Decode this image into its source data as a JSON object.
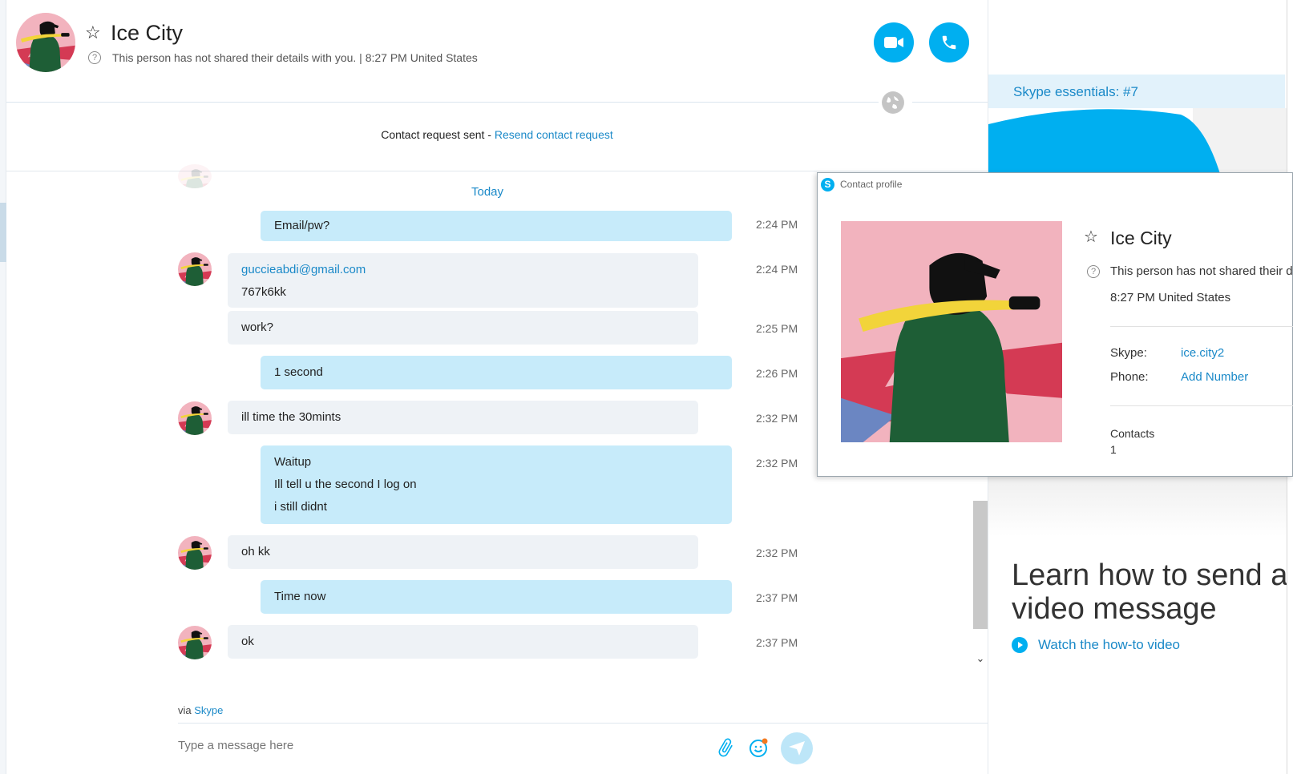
{
  "header": {
    "contact_name": "Ice City",
    "status_text": "This person has not shared their details with you.  |  8:27 PM United States"
  },
  "request": {
    "sent_text": "Contact request sent - ",
    "resend_link": "Resend contact request"
  },
  "chat": {
    "day_label": "Today",
    "messages": [
      {
        "direction": "out",
        "lines": [
          "Email/pw?"
        ],
        "time": "2:24 PM"
      },
      {
        "direction": "in",
        "lines": [
          "guccieabdi@gmail.com",
          "767k6kk"
        ],
        "time": "2:24 PM"
      },
      {
        "direction": "in",
        "lines": [
          "work?"
        ],
        "time": "2:25 PM"
      },
      {
        "direction": "out",
        "lines": [
          "1 second"
        ],
        "time": "2:26 PM"
      },
      {
        "direction": "in",
        "lines": [
          "ill time the 30mints"
        ],
        "time": "2:32 PM"
      },
      {
        "direction": "out",
        "lines": [
          "Waitup",
          "Ill tell u the second I log on",
          "i still didnt"
        ],
        "time": "2:32 PM"
      },
      {
        "direction": "in",
        "lines": [
          "oh kk"
        ],
        "time": "2:32 PM"
      },
      {
        "direction": "out",
        "lines": [
          "Time now"
        ],
        "time": "2:37 PM"
      },
      {
        "direction": "in",
        "lines": [
          "ok"
        ],
        "time": "2:37 PM"
      }
    ]
  },
  "composer": {
    "via_prefix": "via ",
    "via_link": "Skype",
    "placeholder": "Type a message here"
  },
  "side_panel": {
    "essentials": "Skype essentials: #7",
    "learn_title": "Learn how to send a video message",
    "watch_link": "Watch the how-to video"
  },
  "profile_popup": {
    "window_title": "Contact profile",
    "name": "Ice City",
    "details_text": "This person has not shared their de",
    "location": "8:27 PM United States",
    "skype_label": "Skype:",
    "skype_value": "ice.city2",
    "phone_label": "Phone:",
    "phone_value": "Add Number",
    "contacts_label": "Contacts",
    "contacts_value": "1"
  },
  "colors": {
    "accent": "#00aff0",
    "link": "#1a89c8",
    "outgoing_bubble": "#c7ebfa",
    "incoming_bubble": "#eef2f6"
  },
  "icons": [
    "star-icon",
    "help-icon",
    "video-call-icon",
    "call-icon",
    "globe-icon",
    "attach-icon",
    "emoji-icon",
    "send-icon",
    "skype-logo-icon",
    "play-icon",
    "chevron-down-icon"
  ]
}
